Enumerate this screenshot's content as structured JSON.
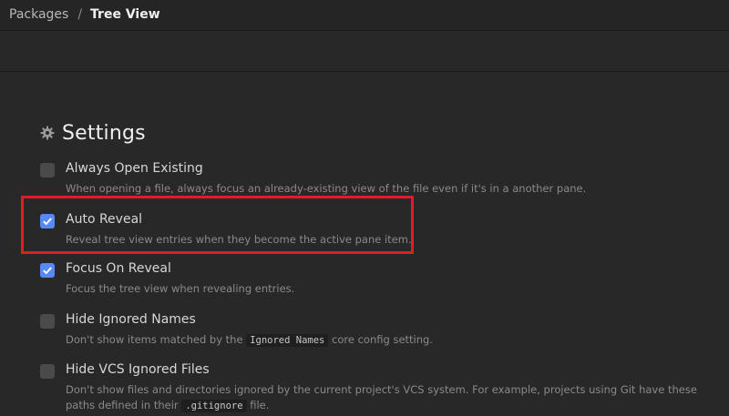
{
  "breadcrumb": {
    "parent": "Packages",
    "separator": "/",
    "current": "Tree View"
  },
  "section": {
    "icon": "gear-icon",
    "title": "Settings"
  },
  "settings": [
    {
      "title": "Always Open Existing",
      "checked": false,
      "description": "When opening a file, always focus an already-existing view of the file even if it's in a another pane."
    },
    {
      "title": "Auto Reveal",
      "checked": true,
      "description": "Reveal tree view entries when they become the active pane item."
    },
    {
      "title": "Focus On Reveal",
      "checked": true,
      "description": "Focus the tree view when revealing entries."
    },
    {
      "title": "Hide Ignored Names",
      "checked": false,
      "description_pre": "Don't show items matched by the",
      "description_code": "Ignored Names",
      "description_post": "core config setting."
    },
    {
      "title": "Hide VCS Ignored Files",
      "checked": false,
      "description_pre": "Don't show files and directories ignored by the current project's VCS system. For example, projects using Git have these paths defined in their",
      "description_code": ".gitignore",
      "description_post": "file."
    }
  ],
  "colors": {
    "accent": "#568af2",
    "highlight": "#e01d25",
    "background": "#282828"
  }
}
